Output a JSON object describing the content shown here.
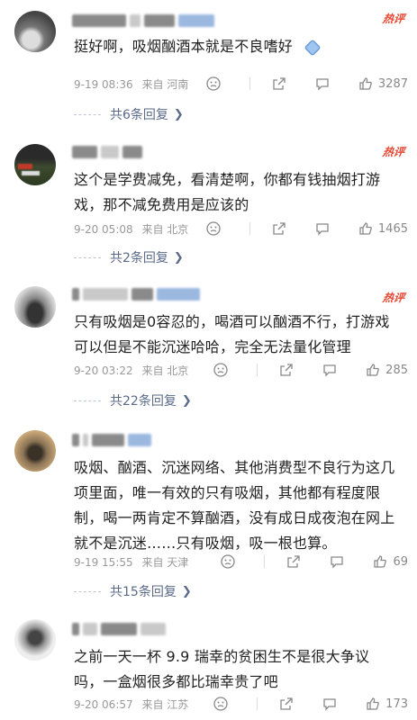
{
  "hot_label": "热评",
  "comments": [
    {
      "text": "挺好啊，吸烟酗酒本就是不良嗜好",
      "time": "9-19 08:36",
      "location": "来自 河南",
      "likes": "3287",
      "replies": "共6条回复",
      "has_emoji": true
    },
    {
      "text": "这个是学费减免，看清楚啊，你都有钱抽烟打游戏，那不减免费用是应该的",
      "time": "9-20 05:08",
      "location": "来自 北京",
      "likes": "1465",
      "replies": "共2条回复"
    },
    {
      "text": "只有吸烟是0容忍的，喝酒可以酗酒不行，打游戏可以但是不能沉迷哈哈，完全无法量化管理",
      "time": "9-20 03:22",
      "location": "来自 北京",
      "likes": "285",
      "replies": "共22条回复"
    },
    {
      "text": "吸烟、酗酒、沉迷网络、其他消费型不良行为这几项里面，唯一有效的只有吸烟，其他都有程度限制，喝一两肯定不算酗酒，没有成日成夜泡在网上就不是沉迷……只有吸烟，吸一根也算。",
      "time": "9-19 15:55",
      "location": "来自 天津",
      "likes": "69",
      "replies": "共15条回复"
    },
    {
      "text": "之前一天一杯 9.9 瑞幸的贫困生不是很大争议吗，一盒烟很多都比瑞幸贵了吧",
      "time": "9-20 06:57",
      "location": "来自 江苏",
      "likes": "173"
    }
  ],
  "colors": {
    "hot": "#e8442f",
    "reply_link": "#5a6a8a",
    "meta": "#999999",
    "text": "#222222"
  },
  "icons": [
    "dizzy-face-icon",
    "share-icon",
    "comment-icon",
    "thumbs-up-icon",
    "diamond-emoji-icon"
  ]
}
